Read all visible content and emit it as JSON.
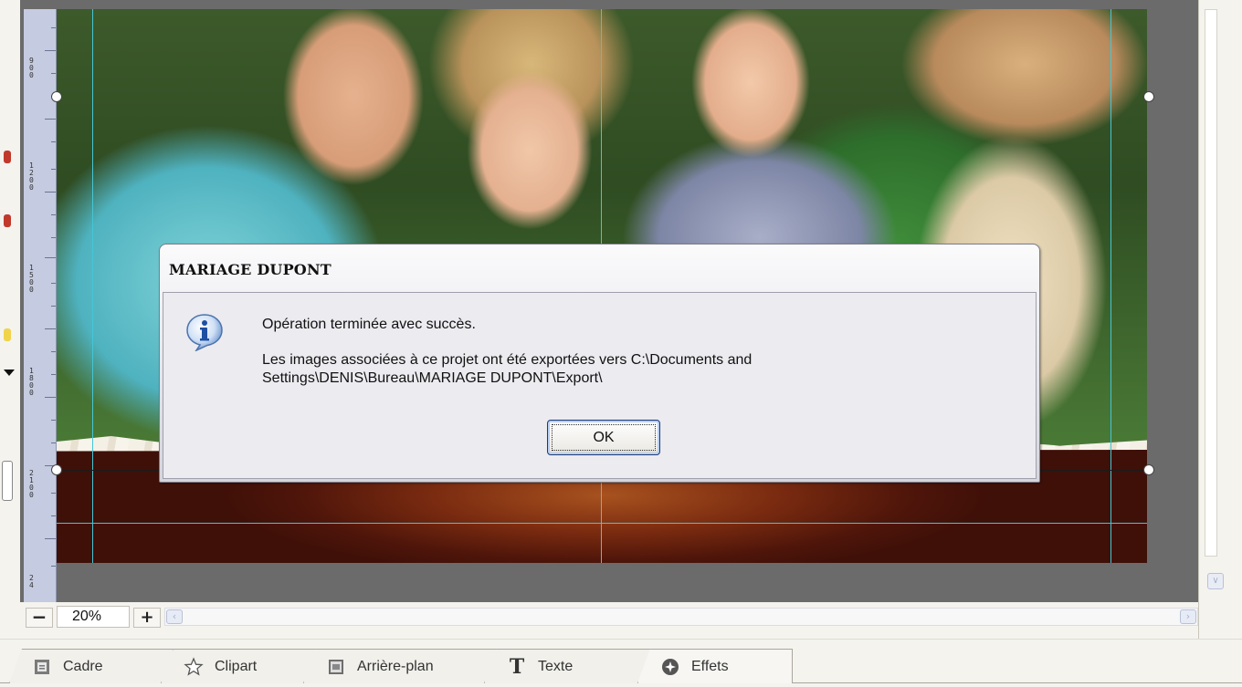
{
  "dialog": {
    "title": "MARIAGE DUPONT",
    "message_line1": "Opération terminée avec succès.",
    "message_line2": "Les images associées à ce projet ont été exportées vers C:\\Documents and Settings\\DENIS\\Bureau\\MARIAGE DUPONT\\Export\\",
    "ok_label": "OK",
    "icon": "info-icon"
  },
  "zoom": {
    "minus_label": "−",
    "value": "20%",
    "plus_label": "+"
  },
  "ruler": {
    "labels": [
      "9\n0\n0",
      "1\n2\n0\n0",
      "1\n5\n0\n0",
      "1\n8\n0\n0",
      "2\n1\n0\n0",
      "2\n4"
    ]
  },
  "tabs": [
    {
      "label": "Cadre",
      "icon": "frame-icon"
    },
    {
      "label": "Clipart",
      "icon": "star-icon"
    },
    {
      "label": "Arrière-plan",
      "icon": "background-icon"
    },
    {
      "label": "Texte",
      "icon": "text-icon"
    },
    {
      "label": "Effets",
      "icon": "effects-icon"
    }
  ],
  "colors": {
    "guide": "#46c6d4",
    "workspace": "#6b6b6b",
    "ruler": "#c5cbe0",
    "banner": "#7a2b10"
  }
}
